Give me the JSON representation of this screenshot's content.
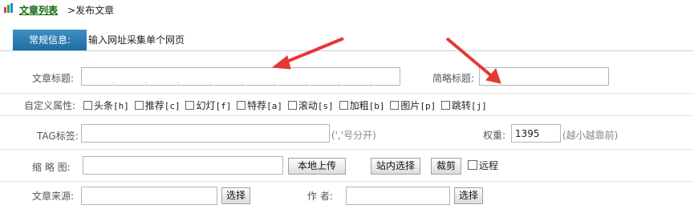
{
  "breadcrumb": {
    "parent": "文章列表",
    "separator": ">",
    "current": "发布文章"
  },
  "tabs": [
    {
      "label": "常规信息:"
    },
    {
      "label": "输入网址采集单个网页"
    }
  ],
  "title_row": {
    "label": "文章标题:",
    "value": "",
    "short_label": "简略标题:",
    "short_value": ""
  },
  "attributes": {
    "label": "自定义属性:",
    "items": [
      {
        "name": "头条",
        "code": "[h]"
      },
      {
        "name": "推荐",
        "code": "[c]"
      },
      {
        "name": "幻灯",
        "code": "[f]"
      },
      {
        "name": "特荐",
        "code": "[a]"
      },
      {
        "name": "滚动",
        "code": "[s]"
      },
      {
        "name": "加粗",
        "code": "[b]"
      },
      {
        "name": "图片",
        "code": "[p]"
      },
      {
        "name": "跳转",
        "code": "[j]"
      }
    ]
  },
  "tag_row": {
    "label": "TAG标签:",
    "value": "",
    "hint": "(','号分开)",
    "weight_label": "权重:",
    "weight_value": "1395",
    "weight_hint": "(越小越靠前)"
  },
  "thumb_row": {
    "label": "缩 略 图:",
    "value": "",
    "upload": "本地上传",
    "site_select": "站内选择",
    "crop": "裁剪",
    "remote": "远程"
  },
  "source_row": {
    "label": "文章来源:",
    "value": "",
    "select": "选择",
    "author_label": "作 者:",
    "author_value": "",
    "author_select": "选择"
  },
  "colors": {
    "accent": "#2a7ab4",
    "arrow": "#e53935",
    "link": "#0f6a0f"
  }
}
